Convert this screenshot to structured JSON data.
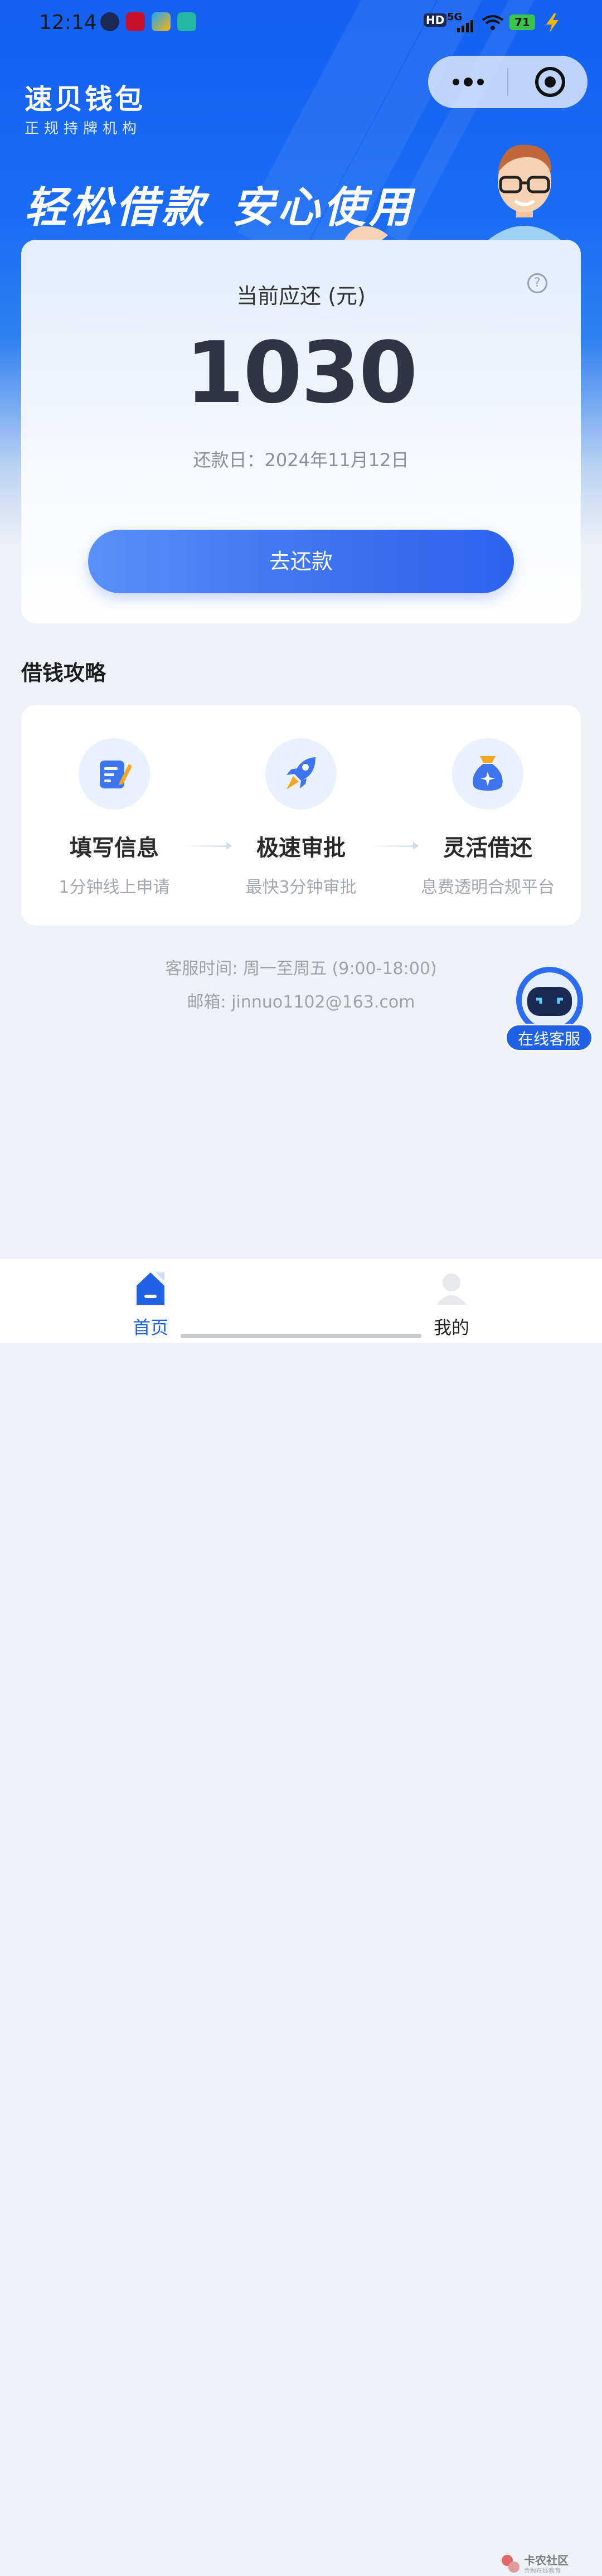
{
  "status_bar": {
    "time": "12:14",
    "network": "5G",
    "hd": "HD",
    "battery": "71"
  },
  "header": {
    "brand_title": "速贝钱包",
    "brand_subtitle": "正规持牌机构",
    "slogan_left": "轻松借款",
    "slogan_right": "安心使用"
  },
  "repayment": {
    "label": "当前应还 (元)",
    "amount": "1030",
    "due_date": "还款日：2024年11月12日",
    "button": "去还款"
  },
  "guide": {
    "title": "借钱攻略",
    "steps": [
      {
        "title": "填写信息",
        "desc": "1分钟线上申请",
        "icon": "edit-form-icon"
      },
      {
        "title": "极速审批",
        "desc": "最快3分钟审批",
        "icon": "rocket-icon"
      },
      {
        "title": "灵活借还",
        "desc": "息费透明合规平台",
        "icon": "money-bag-icon"
      }
    ]
  },
  "contact": {
    "service_hours": "客服时间: 周一至周五 (9:00-18:00)",
    "email": "邮箱: jinnuo1102@163.com",
    "online_service": "在线客服"
  },
  "tabbar": {
    "home": "首页",
    "mine": "我的"
  },
  "watermark": {
    "title": "卡农社区",
    "subtitle": "金融在线教育"
  },
  "colors": {
    "brand_blue": "#1a6cf5",
    "button_blue": "#3f76f3",
    "active_tab": "#1f62e6"
  }
}
